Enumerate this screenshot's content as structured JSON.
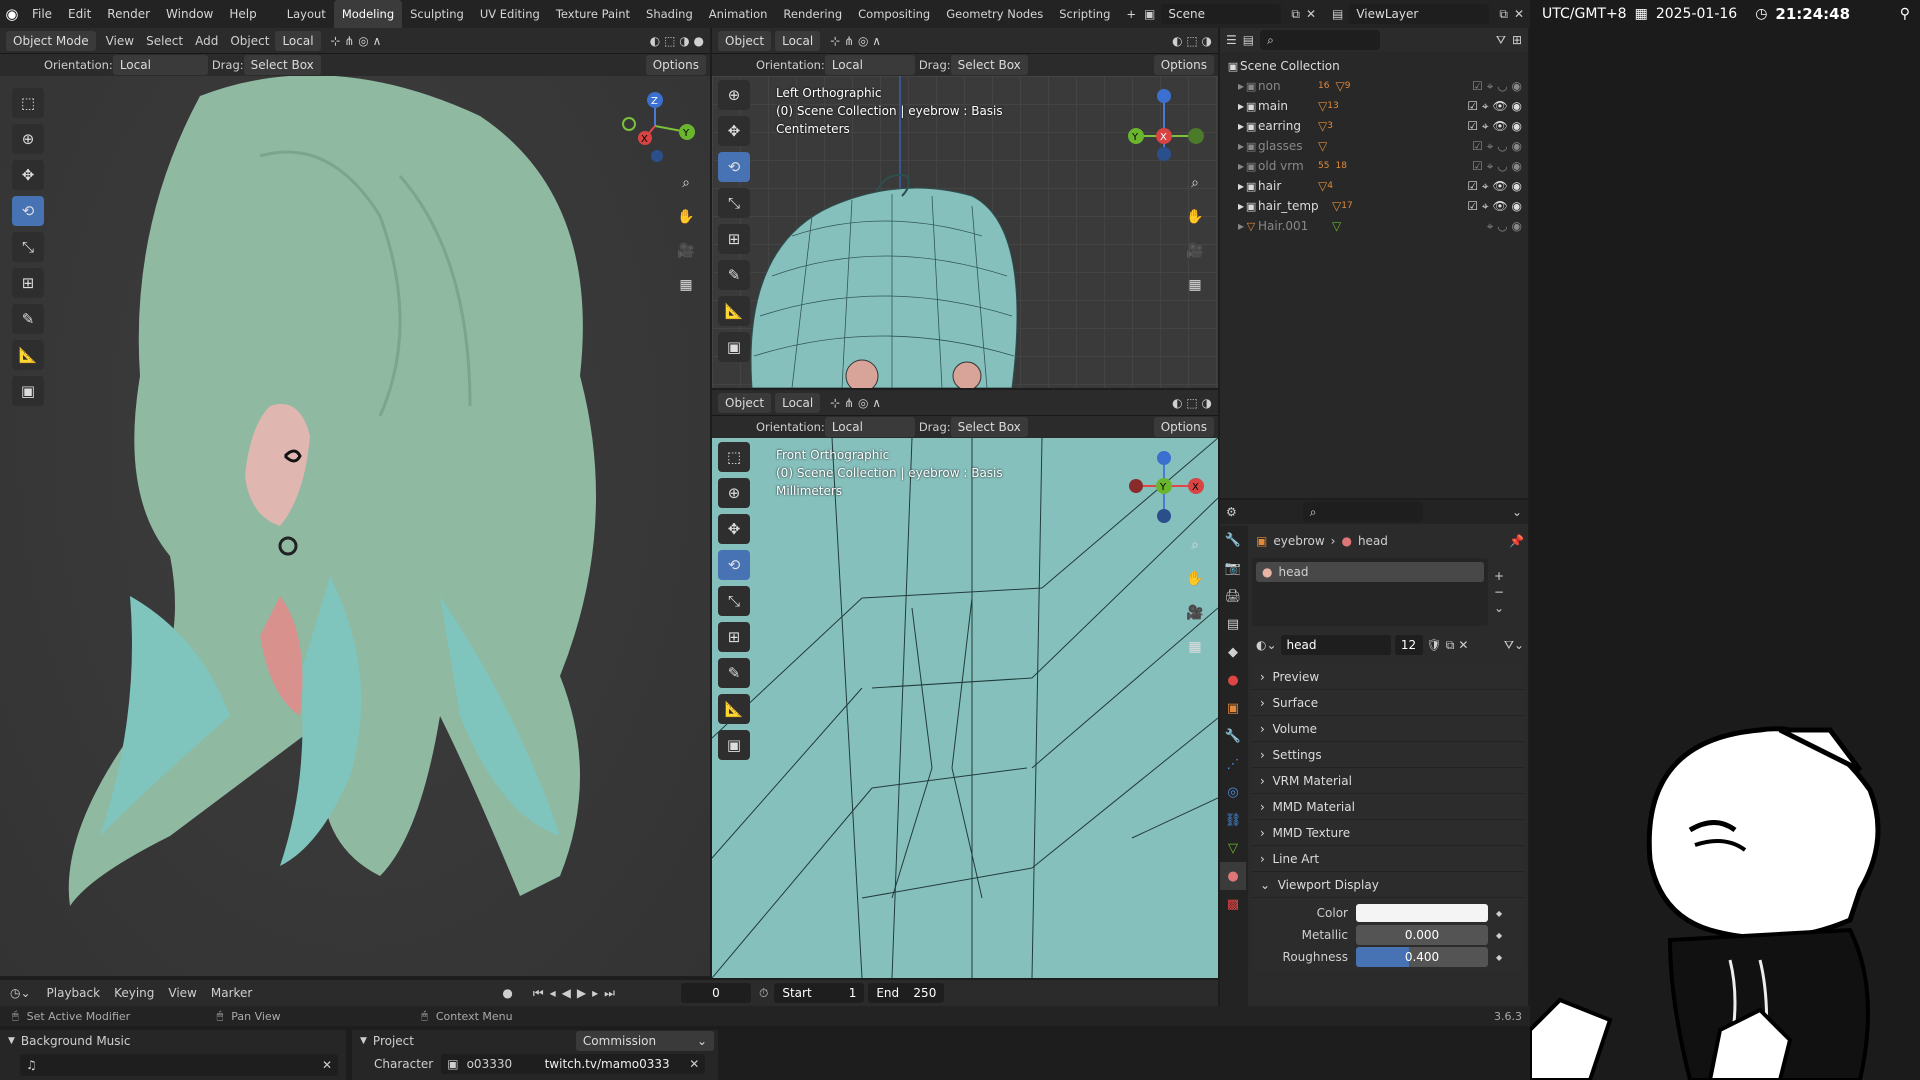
{
  "topbar": {
    "menu": [
      "File",
      "Edit",
      "Render",
      "Window",
      "Help"
    ],
    "workspaces": [
      "Layout",
      "Modeling",
      "Sculpting",
      "UV Editing",
      "Texture Paint",
      "Shading",
      "Animation",
      "Rendering",
      "Compositing",
      "Geometry Nodes",
      "Scripting"
    ],
    "active_workspace": "Modeling",
    "scene": "Scene",
    "view_layer": "ViewLayer"
  },
  "clock": {
    "timezone": "UTC/GMT+8",
    "date": "2025-01-16",
    "time": "21:24:48"
  },
  "viewport_left": {
    "mode": "Object Mode",
    "menu": [
      "View",
      "Select",
      "Add",
      "Object"
    ],
    "transform": "Local",
    "orientation_label": "Orientation:",
    "orientation": "Local",
    "drag_label": "Drag:",
    "drag": "Select Box",
    "options": "Options"
  },
  "viewport_top": {
    "mode": "Object",
    "transform": "Local",
    "orientation_label": "Orientation:",
    "orientation": "Local",
    "drag_label": "Drag:",
    "drag": "Select Box",
    "options": "Options",
    "info": [
      "Left Orthographic",
      "(0) Scene Collection | eyebrow : Basis",
      "Centimeters"
    ]
  },
  "viewport_bottom": {
    "mode": "Object",
    "transform": "Local",
    "orientation_label": "Orientation:",
    "orientation": "Local",
    "drag_label": "Drag:",
    "drag": "Select Box",
    "options": "Options",
    "info": [
      "Front Orthographic",
      "(0) Scene Collection | eyebrow : Basis",
      "Millimeters"
    ]
  },
  "outliner": {
    "root": "Scene Collection",
    "items": [
      {
        "name": "non",
        "count1": "16",
        "count2": "9",
        "dim": true
      },
      {
        "name": "main",
        "count1": "13",
        "dim": false
      },
      {
        "name": "earring",
        "count1": "3",
        "dim": false
      },
      {
        "name": "glasses",
        "dim": true
      },
      {
        "name": "old vrm",
        "count1": "55",
        "count2": "18",
        "dim": true
      },
      {
        "name": "hair",
        "count1": "4",
        "dim": false
      },
      {
        "name": "hair_temp",
        "count1": "17",
        "dim": false
      },
      {
        "name": "Hair.001",
        "dim": true
      }
    ]
  },
  "properties": {
    "breadcrumb_object": "eyebrow",
    "breadcrumb_material": "head",
    "slot": "head",
    "material_name": "head",
    "users": "12",
    "panels": [
      "Preview",
      "Surface",
      "Volume",
      "Settings",
      "VRM Material",
      "MMD Material",
      "MMD Texture",
      "Line Art"
    ],
    "open_panel": "Viewport Display",
    "color_label": "Color",
    "metallic_label": "Metallic",
    "metallic": "0.000",
    "metallic_fraction": 0,
    "roughness_label": "Roughness",
    "roughness": "0.400",
    "roughness_fraction": 0.4
  },
  "timeline": {
    "menu": [
      "Playback",
      "Keying",
      "View",
      "Marker"
    ],
    "frame": "0",
    "start_label": "Start",
    "start": "1",
    "end_label": "End",
    "end": "250"
  },
  "statusbar": {
    "left": "Set Active Modifier",
    "mid": "Pan View",
    "right": "Context Menu",
    "version": "3.6.3"
  },
  "bottom_left": {
    "title": "Background Music"
  },
  "bottom_mid": {
    "title": "Project",
    "project_value": "Commission",
    "character_label": "Character",
    "character_value": "o03330",
    "stream": "twitch.tv/mamo0333"
  },
  "colors": {
    "accent": "#4772b3",
    "hair": "#8fb9a1",
    "mesh": "#7fbcbc"
  }
}
